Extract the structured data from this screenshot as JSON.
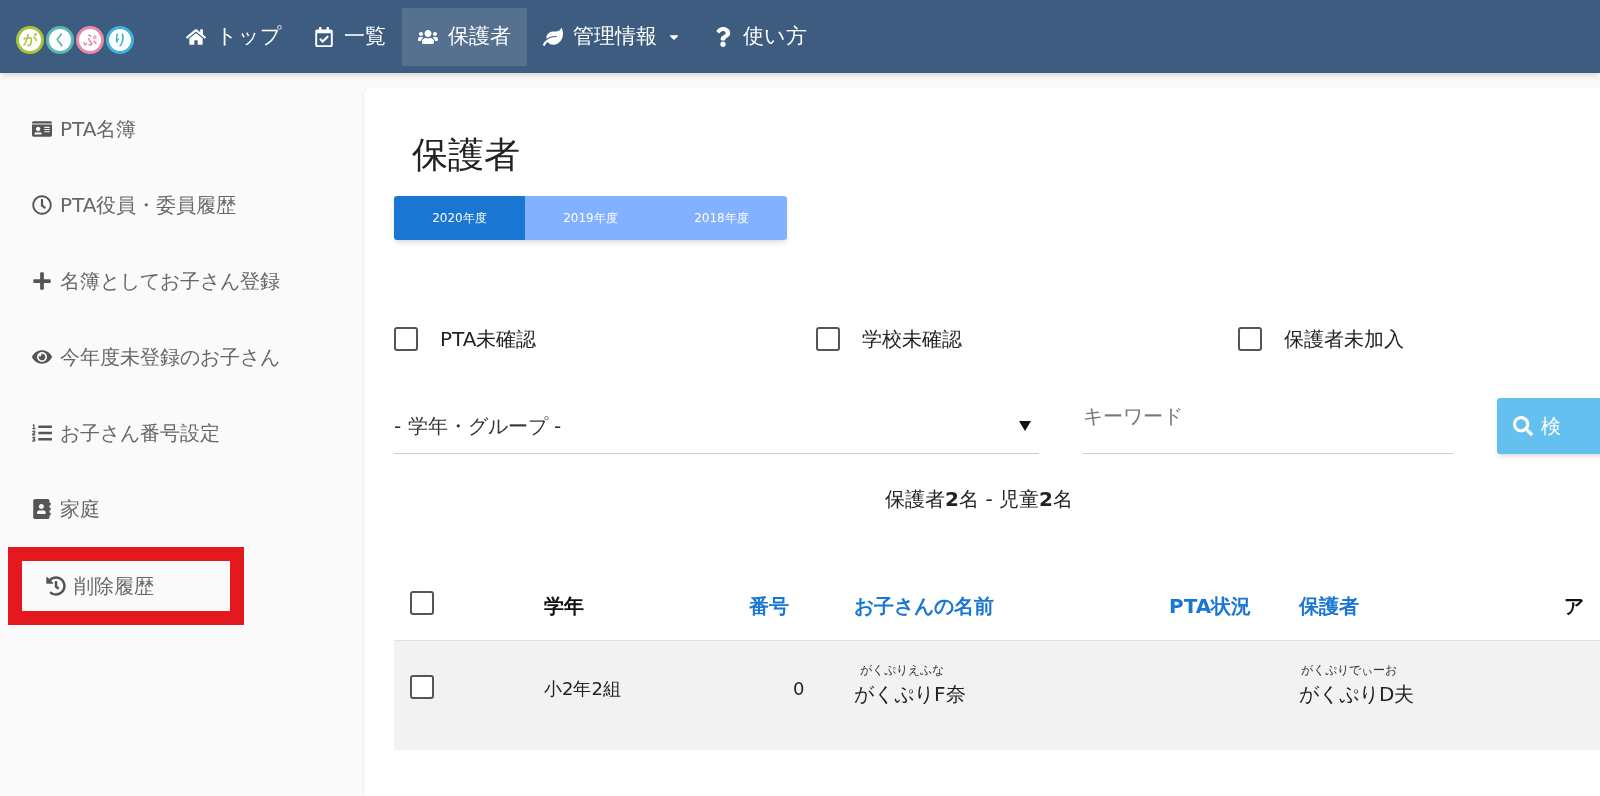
{
  "navbar": {
    "logo": [
      "が",
      "く",
      "ぷ",
      "り"
    ],
    "items": [
      {
        "kind": "home",
        "label": "トップ",
        "selected": false,
        "dropdown": false
      },
      {
        "kind": "calendar",
        "label": "一覧",
        "selected": false,
        "dropdown": false
      },
      {
        "kind": "users",
        "label": "保護者",
        "selected": true,
        "dropdown": false
      },
      {
        "kind": "leaf",
        "label": "管理情報",
        "selected": false,
        "dropdown": true
      },
      {
        "kind": "question",
        "label": "使い方",
        "selected": false,
        "dropdown": false
      }
    ]
  },
  "sidebar": {
    "items": [
      {
        "kind": "card",
        "label": "PTA名簿",
        "highlighted": false
      },
      {
        "kind": "clock",
        "label": "PTA役員・委員履歴",
        "highlighted": false
      },
      {
        "kind": "plus",
        "label": "名簿としてお子さん登録",
        "highlighted": false
      },
      {
        "kind": "eye",
        "label": "今年度未登録のお子さん",
        "highlighted": false
      },
      {
        "kind": "list",
        "label": "お子さん番号設定",
        "highlighted": false
      },
      {
        "kind": "contact",
        "label": "家庭",
        "highlighted": false
      },
      {
        "kind": "history",
        "label": "削除履歴",
        "highlighted": true
      }
    ]
  },
  "page": {
    "title": "保護者",
    "year_tabs": [
      {
        "label": "2020年度",
        "selected": true
      },
      {
        "label": "2019年度",
        "selected": false
      },
      {
        "label": "2018年度",
        "selected": false
      }
    ],
    "filters": [
      {
        "label": "PTA未確認",
        "checked": false
      },
      {
        "label": "学校未確認",
        "checked": false
      },
      {
        "label": "保護者未加入",
        "checked": false
      }
    ],
    "group_select": {
      "value": "- 学年・グループ -"
    },
    "keyword": {
      "placeholder": "キーワード"
    },
    "search_button": "検",
    "summary": "保護者**2**名 - 児童**2**名",
    "table": {
      "select_all": false,
      "columns": [
        {
          "label": "学年",
          "sortable": false
        },
        {
          "label": "番号",
          "sortable": true
        },
        {
          "label": "お子さんの名前",
          "sortable": true
        },
        {
          "label": "PTA状況",
          "sortable": true
        },
        {
          "label": "保護者",
          "sortable": true
        },
        {
          "label": "ア",
          "sortable": false
        }
      ],
      "rows": [
        {
          "checked": false,
          "grade": "小2年2組",
          "number": "0",
          "child_reading": "がくぷりえふな",
          "child": "がくぷりF奈",
          "guardian_reading": "がくぷりでぃーお",
          "guardian": "がくぷりD夫"
        }
      ]
    }
  }
}
